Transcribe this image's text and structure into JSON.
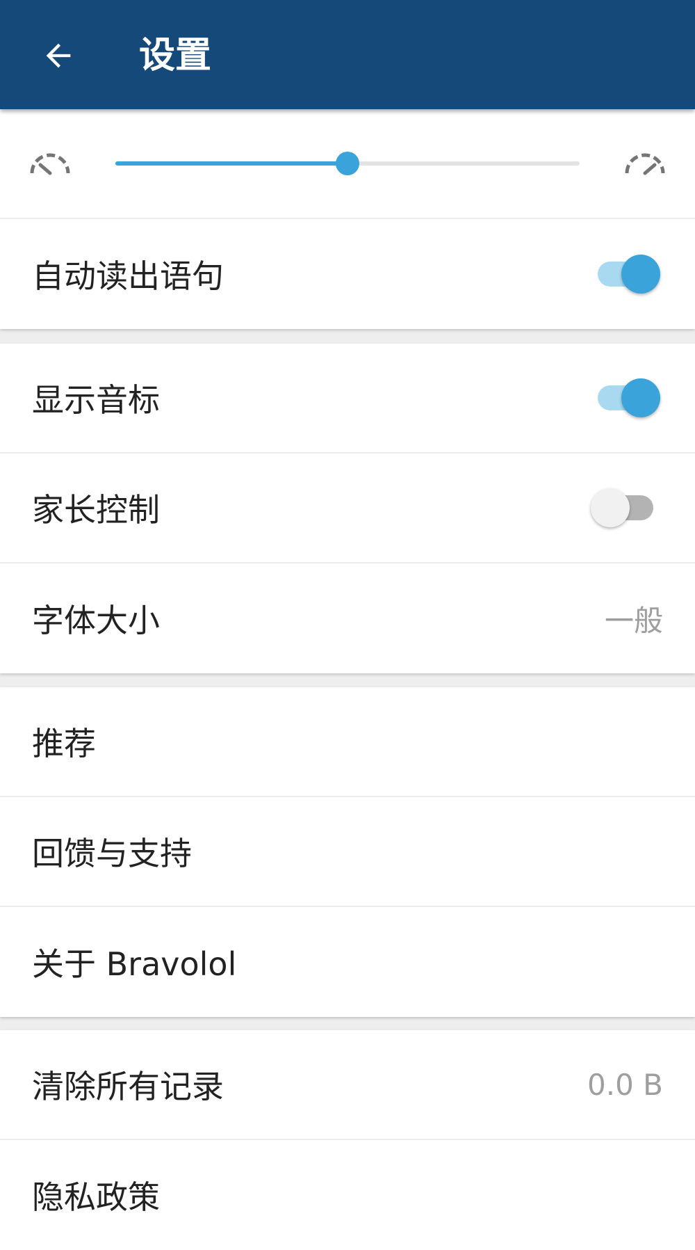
{
  "header": {
    "title": "设置",
    "back_icon": "arrow-left-icon"
  },
  "speed": {
    "slow_icon": "speedometer-slow-icon",
    "fast_icon": "speedometer-fast-icon",
    "value_fraction": 0.5
  },
  "reading": {
    "auto_read_label": "自动读出语句",
    "auto_read_on": true
  },
  "display": {
    "phonetic_label": "显示音标",
    "phonetic_on": true,
    "parental_label": "家长控制",
    "parental_on": false,
    "font_size_label": "字体大小",
    "font_size_value": "一般"
  },
  "about": {
    "recommend_label": "推荐",
    "feedback_label": "回馈与支持",
    "about_label": "关于 Bravolol"
  },
  "data": {
    "clear_label": "清除所有记录",
    "clear_value": "0.0 B",
    "privacy_label": "隐私政策"
  },
  "colors": {
    "app_bar": "#15497a",
    "accent": "#3aa3d9"
  }
}
